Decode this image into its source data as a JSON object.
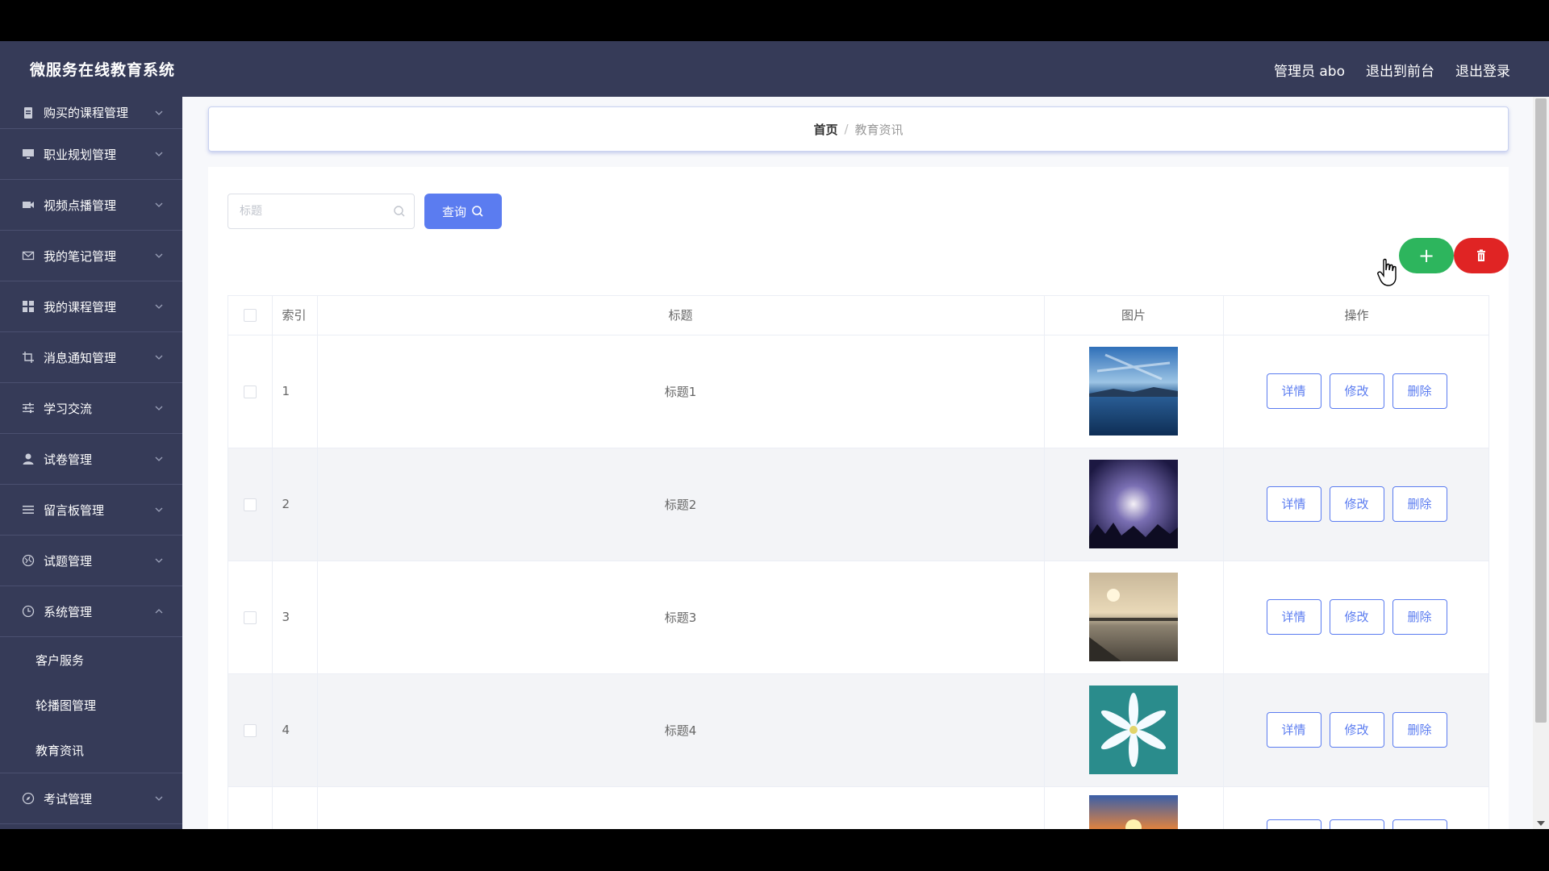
{
  "header": {
    "title": "微服务在线教育系统",
    "admin_label": "管理员 abo",
    "back_front": "退出到前台",
    "logout": "退出登录"
  },
  "sidebar": {
    "items": [
      {
        "label": "购买的课程管理",
        "icon": "document-icon"
      },
      {
        "label": "职业规划管理",
        "icon": "monitor-icon"
      },
      {
        "label": "视频点播管理",
        "icon": "video-icon"
      },
      {
        "label": "我的笔记管理",
        "icon": "mail-icon"
      },
      {
        "label": "我的课程管理",
        "icon": "grid-icon"
      },
      {
        "label": "消息通知管理",
        "icon": "crop-icon"
      },
      {
        "label": "学习交流",
        "icon": "sliders-icon"
      },
      {
        "label": "试卷管理",
        "icon": "user-icon"
      },
      {
        "label": "留言板管理",
        "icon": "list-icon"
      },
      {
        "label": "试题管理",
        "icon": "globe-icon"
      },
      {
        "label": "系统管理",
        "icon": "clock-icon"
      },
      {
        "label": "考试管理",
        "icon": "compass-icon"
      }
    ],
    "system_sub": [
      "客户服务",
      "轮播图管理",
      "教育资讯"
    ]
  },
  "breadcrumb": {
    "home": "首页",
    "separator": "/",
    "current": "教育资讯"
  },
  "search": {
    "placeholder": "标题",
    "value": "",
    "button": "查询"
  },
  "toolbar": {
    "add": "+"
  },
  "table": {
    "headers": {
      "index": "索引",
      "title": "标题",
      "image": "图片",
      "actions": "操作"
    },
    "rows": [
      {
        "index": "1",
        "title": "标题1"
      },
      {
        "index": "2",
        "title": "标题2"
      },
      {
        "index": "3",
        "title": "标题3"
      },
      {
        "index": "4",
        "title": "标题4"
      },
      {
        "index": "",
        "title": ""
      }
    ],
    "actions": {
      "detail": "详情",
      "edit": "修改",
      "delete": "删除"
    }
  },
  "colors": {
    "primary": "#5b7cf0",
    "header_bg": "#363b58",
    "success": "#2db55d",
    "danger": "#e02424"
  }
}
